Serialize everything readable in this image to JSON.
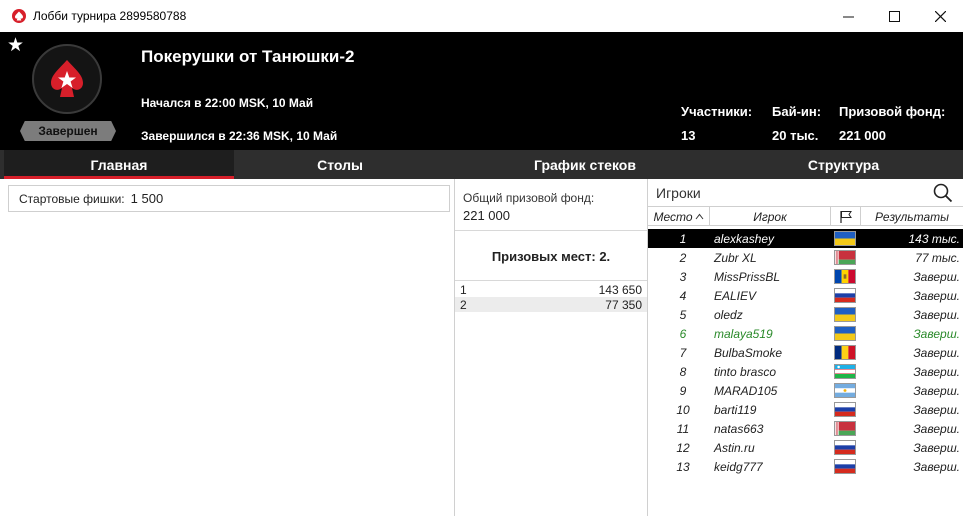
{
  "window": {
    "title": "Лобби турнира 2899580788",
    "minimize": "—",
    "maximize": "☐",
    "close": "✕"
  },
  "header": {
    "name": "Покерушки от Танюшки-2",
    "status": "Завершен",
    "started": "Начался в 22:00 MSK, 10 Май",
    "ended": "Завершился в 22:36 MSK, 10 Май",
    "stats": [
      {
        "label": "Участники:",
        "value": "13"
      },
      {
        "label": "Бай-ин:",
        "value": "20 тыс."
      },
      {
        "label": "Призовой фонд:",
        "value": "221 000"
      }
    ]
  },
  "tabs": [
    "Главная",
    "Столы",
    "График стеков",
    "Структура"
  ],
  "main": {
    "starting_chips_label": "Стартовые фишки:",
    "starting_chips_value": "1 500"
  },
  "prize": {
    "pool_label": "Общий призовой фонд:",
    "pool_value": "221 000",
    "places_label": "Призовых мест: 2.",
    "rows": [
      {
        "place": "1",
        "amount": "143 650"
      },
      {
        "place": "2",
        "amount": "77 350"
      }
    ]
  },
  "players": {
    "title": "Игроки",
    "columns": {
      "place": "Место",
      "player": "Игрок",
      "results": "Результаты"
    },
    "rows": [
      {
        "place": "1",
        "name": "alexkashey",
        "flag": "ua",
        "result": "143 тыс."
      },
      {
        "place": "2",
        "name": "Zubr XL",
        "flag": "by",
        "result": "77 тыс."
      },
      {
        "place": "3",
        "name": "MissPrissBL",
        "flag": "md",
        "result": "Заверш."
      },
      {
        "place": "4",
        "name": "EALIEV",
        "flag": "ru",
        "result": "Заверш."
      },
      {
        "place": "5",
        "name": "oledz",
        "flag": "ua",
        "result": "Заверш."
      },
      {
        "place": "6",
        "name": "malaya519",
        "flag": "ua",
        "result": "Заверш."
      },
      {
        "place": "7",
        "name": "BulbaSmoke",
        "flag": "ro",
        "result": "Заверш."
      },
      {
        "place": "8",
        "name": "tinto brasco",
        "flag": "uz",
        "result": "Заверш."
      },
      {
        "place": "9",
        "name": "MARAD105",
        "flag": "ar",
        "result": "Заверш."
      },
      {
        "place": "10",
        "name": "barti119",
        "flag": "ru",
        "result": "Заверш."
      },
      {
        "place": "11",
        "name": "natas663",
        "flag": "by",
        "result": "Заверш."
      },
      {
        "place": "12",
        "name": "Astin.ru",
        "flag": "ru",
        "result": "Заверш."
      },
      {
        "place": "13",
        "name": "keidg777",
        "flag": "ru",
        "result": "Заверш."
      }
    ]
  },
  "colors": {
    "accent": "#d71f2a",
    "header_bg": "#000000",
    "tab_bg": "#2e2e2e",
    "highlight_text": "#2a8a2a"
  }
}
